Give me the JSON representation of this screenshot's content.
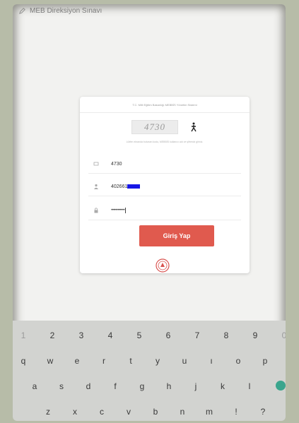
{
  "app": {
    "title": "MEB Direksiyon Sınavı"
  },
  "card": {
    "header": "T.C. Milli Eğitim Bakanlığı MEBBİS Yönetim Sistemi",
    "captcha": "4730",
    "info": "Lütfen ekranda bulunan kodu, MEBBİS kullanıcı adı ve şifrenizi giriniz.",
    "fields": {
      "code": "4730",
      "username": "402661",
      "password": "••••••••••••"
    },
    "login_label": "Giriş Yap"
  },
  "keyboard": {
    "numbers": [
      "1",
      "2",
      "3",
      "4",
      "5",
      "6",
      "7",
      "8",
      "9",
      "0"
    ],
    "row1": [
      "q",
      "w",
      "e",
      "r",
      "t",
      "y",
      "u",
      "ı",
      "o",
      "p"
    ],
    "row2": [
      "a",
      "s",
      "d",
      "f",
      "g",
      "h",
      "j",
      "k",
      "l"
    ],
    "row3": [
      "z",
      "x",
      "c",
      "v",
      "b",
      "n",
      "m",
      "!",
      "?"
    ]
  },
  "colors": {
    "primary_button": "#e05a4e",
    "enter_key": "#3aa58d",
    "redaction": "#1717e6"
  }
}
